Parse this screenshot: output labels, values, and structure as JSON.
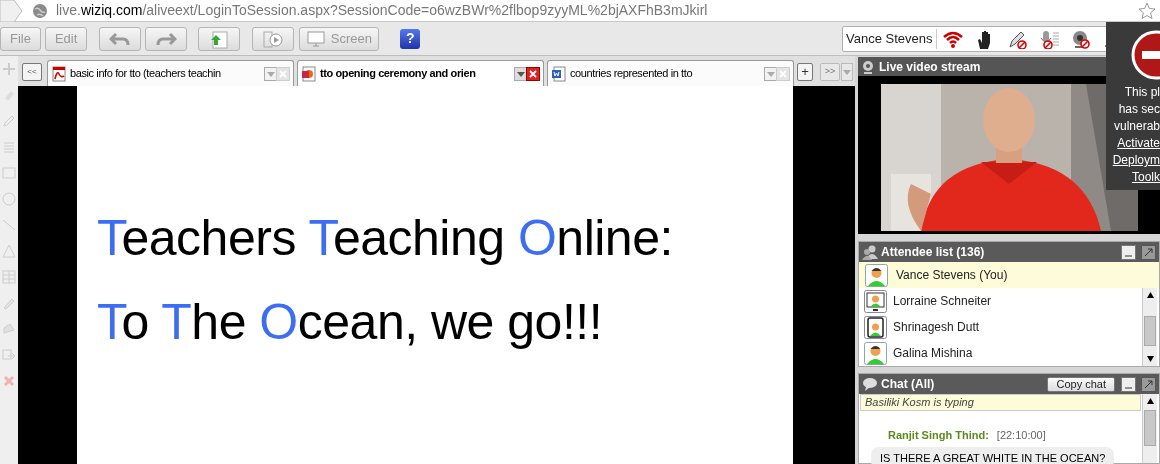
{
  "address_bar": {
    "url_host_prefix": "live.",
    "url_domain": "wiziq.com",
    "url_path": "/aliveext/LoginToSession.aspx?SessionCode=o6wzBWr%2flbop9zyyML%2bjAXFhB3mJkirl"
  },
  "toolbar": [
    {
      "kind": "text",
      "label": "File"
    },
    {
      "kind": "text",
      "label": "Edit"
    },
    {
      "kind": "undo"
    },
    {
      "kind": "redo"
    },
    {
      "kind": "upload"
    },
    {
      "kind": "media"
    },
    {
      "kind": "screen",
      "label": "Screen"
    },
    {
      "kind": "help",
      "label": "?"
    }
  ],
  "user": {
    "name": "Vance Stevens"
  },
  "tabs": [
    {
      "label": "basic info for tto (teachers teachin",
      "kind": "pdf",
      "selected": false
    },
    {
      "label": "tto opening ceremony and orien",
      "kind": "ppt",
      "selected": true
    },
    {
      "label": "countries represented in tto",
      "kind": "doc",
      "selected": false
    }
  ],
  "tab_nav": {
    "back": "<<",
    "add": "+",
    "forward": ">>"
  },
  "slide": {
    "lines": [
      [
        {
          "text": "T",
          "highlight": true
        },
        {
          "text": "eachers ",
          "highlight": false
        },
        {
          "text": "T",
          "highlight": true
        },
        {
          "text": "eaching ",
          "highlight": false
        },
        {
          "text": "O",
          "highlight": true
        },
        {
          "text": "nline:",
          "highlight": false
        }
      ],
      [
        {
          "text": "T",
          "highlight": true
        },
        {
          "text": "o ",
          "highlight": false
        },
        {
          "text": "T",
          "highlight": true
        },
        {
          "text": "he ",
          "highlight": false
        },
        {
          "text": "O",
          "highlight": true
        },
        {
          "text": "cean, we go!!!",
          "highlight": false
        }
      ]
    ]
  },
  "video": {
    "title": "Live video stream"
  },
  "plugin_notice": {
    "lines": [
      "This pl",
      "has sec",
      "vulnerab"
    ],
    "links": [
      "Activate",
      "Deploym",
      "Toolk"
    ]
  },
  "attendees": {
    "title": "Attendee list (136)",
    "items": [
      {
        "name": "Vance Stevens (You)",
        "kind": "person",
        "selected": true
      },
      {
        "name": "Lorraine Schneiter",
        "kind": "desktop",
        "selected": false
      },
      {
        "name": "Shrinagesh Dutt",
        "kind": "phone",
        "selected": false
      },
      {
        "name": "Galina Mishina",
        "kind": "person",
        "selected": false
      }
    ]
  },
  "chat": {
    "title": "Chat (All)",
    "copy_button": "Copy chat",
    "typing": "Basiliki Kosm is typing",
    "messages": [
      {
        "author": "Ranjit Singh Thind:",
        "time": "[22:10:00]",
        "text": "IS THERE A GREAT WHITE IN THE OCEAN?"
      }
    ]
  }
}
